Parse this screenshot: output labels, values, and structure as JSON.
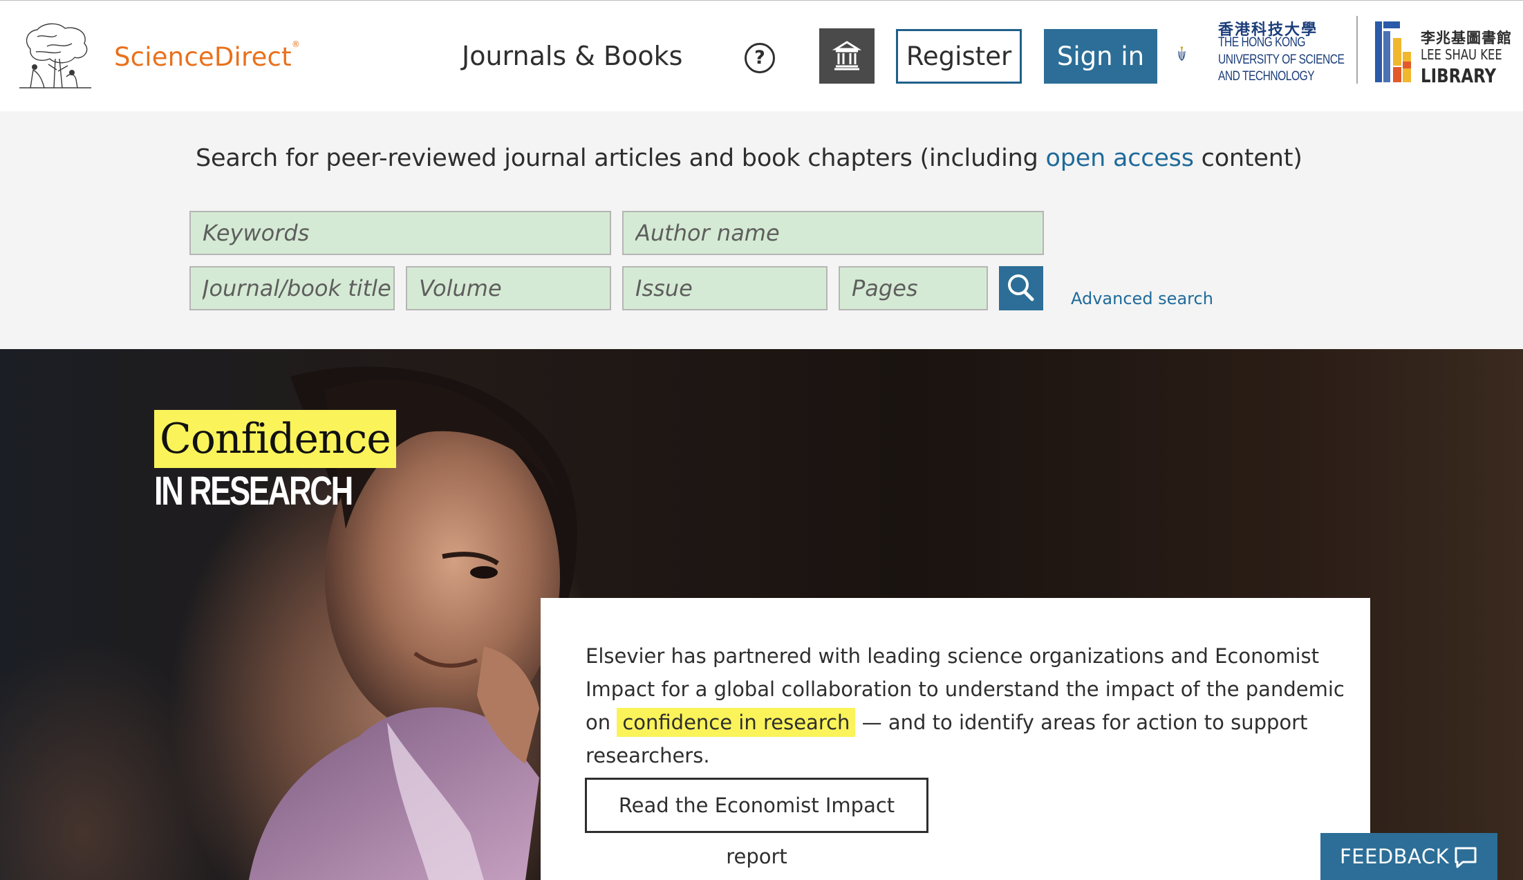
{
  "header": {
    "brand_name": "ScienceDirect",
    "brand_mark": "®",
    "nav_journals": "Journals & Books",
    "help_label": "?",
    "register_label": "Register",
    "signin_label": "Sign in",
    "institution_icon": "institution-icon",
    "hkust": {
      "zh": "香港科技大學",
      "line1": "THE HONG KONG",
      "line2": "UNIVERSITY OF SCIENCE",
      "line3": "AND TECHNOLOGY"
    },
    "library": {
      "zh": "李兆基圖書館",
      "line1": "LEE SHAU KEE",
      "line2": "LIBRARY"
    }
  },
  "search": {
    "heading_before": "Search for peer-reviewed journal articles and book chapters (including ",
    "heading_link": "open access",
    "heading_after": " content)",
    "keywords_placeholder": "Keywords",
    "author_placeholder": "Author name",
    "journal_placeholder": "Journal/book title",
    "volume_placeholder": "Volume",
    "issue_placeholder": "Issue",
    "pages_placeholder": "Pages",
    "search_icon": "search-icon",
    "advanced_label": "Advanced search"
  },
  "hero": {
    "title_highlight": "Confidence",
    "title_sub": "IN RESEARCH",
    "text_before": "Elsevier has partnered with leading science organizations and Economist Impact for a global collaboration to understand the impact of the pandemic on ",
    "text_highlight": "confidence in research",
    "text_after": " — and to identify areas for action to support researchers.",
    "button_label": "Read the Economist Impact report"
  },
  "feedback": {
    "label": "FEEDBACK",
    "icon": "speech-bubble-icon"
  },
  "colors": {
    "brand_orange": "#e9711c",
    "primary_blue": "#2c6e97",
    "link_blue": "#1f6a9a",
    "highlight_yellow": "#faf35a",
    "field_green": "#d5ead4"
  }
}
